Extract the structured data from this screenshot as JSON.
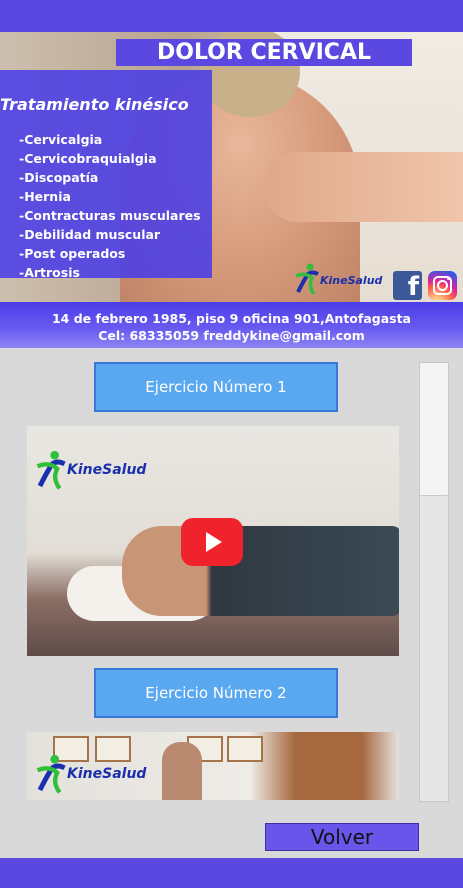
{
  "header": {
    "title": "DOLOR CERVICAL",
    "subtitle": "Tratamiento kinésico",
    "conditions": [
      "-Cervicalgia",
      "-Cervicobraquialgia",
      "-Discopatía",
      "-Hernia",
      "-Contracturas musculares",
      "-Debilidad muscular",
      "-Post operados",
      "-Artrosis"
    ],
    "brand": "KineSalud",
    "social": [
      "facebook-icon",
      "instagram-icon"
    ]
  },
  "contact": {
    "address": "14 de febrero 1985, piso 9 oficina 901,Antofagasta",
    "phone_email": "Cel: 68335059 freddykine@gmail.com"
  },
  "exercises": [
    {
      "label": "Ejercicio Número 1",
      "video_brand": "KineSalud"
    },
    {
      "label": "Ejercicio Número 2",
      "video_brand": "KineSalud"
    }
  ],
  "footer": {
    "back_label": "Volver"
  },
  "colors": {
    "primary": "#5a48e0",
    "button": "#5aa9f0",
    "play": "#f0222b"
  }
}
